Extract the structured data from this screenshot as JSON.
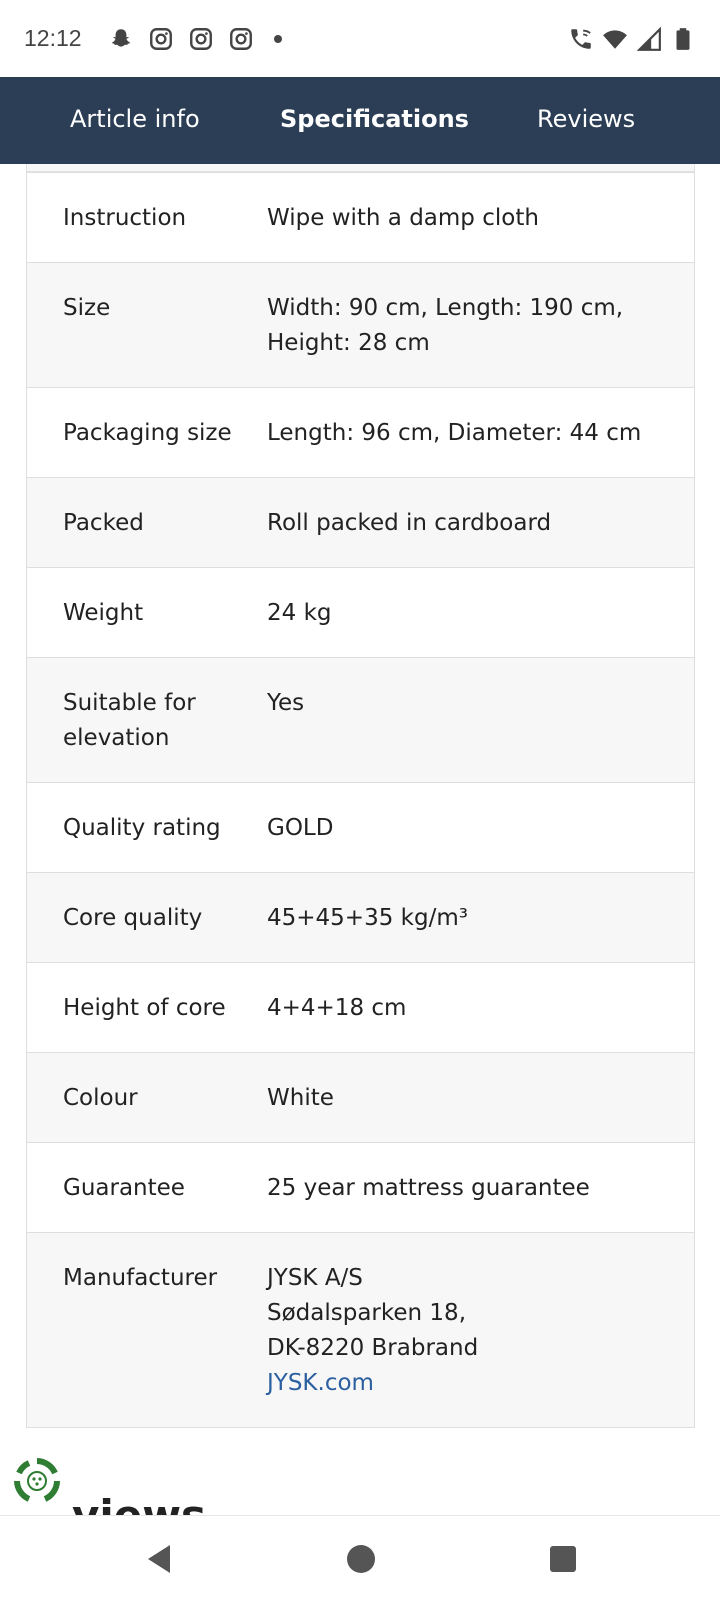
{
  "status_bar": {
    "time": "12:12",
    "left_icons": [
      "snapchat-icon",
      "instagram-icon",
      "instagram-icon",
      "instagram-icon"
    ],
    "right_icons": [
      "wifi-call-icon",
      "wifi-icon",
      "signal-icon",
      "battery-icon"
    ]
  },
  "tabs": [
    {
      "label": "Article info",
      "active": false
    },
    {
      "label": "Specifications",
      "active": true
    },
    {
      "label": "Reviews",
      "active": false
    }
  ],
  "specs": [
    {
      "label": "Instruction",
      "value": "Wipe with a damp cloth"
    },
    {
      "label": "Size",
      "value": "Width: 90 cm, Length: 190 cm, Height: 28 cm"
    },
    {
      "label": "Packaging size",
      "value": "Length: 96 cm, Diameter: 44 cm"
    },
    {
      "label": "Packed",
      "value": "Roll packed in cardboard"
    },
    {
      "label": "Weight",
      "value": "24 kg"
    },
    {
      "label": "Suitable for elevation",
      "value": "Yes"
    },
    {
      "label": "Quality rating",
      "value": "GOLD"
    },
    {
      "label": "Core quality",
      "value": "45+45+35 kg/m³"
    },
    {
      "label": "Height of core",
      "value": "4+4+18 cm"
    },
    {
      "label": "Colour",
      "value": "White"
    },
    {
      "label": "Guarantee",
      "value": "25 year mattress guarantee"
    }
  ],
  "manufacturer": {
    "label": "Manufacturer",
    "name": "JYSK A/S",
    "street": "Sødalsparken 18,",
    "city": "DK-8220 Brabrand",
    "link": "JYSK.com"
  },
  "views_heading": "views",
  "colors": {
    "tab_bar": "#2b3e55",
    "link": "#2b5fa0",
    "alt_row": "#f7f7f7",
    "fab_green": "#2e7d32"
  }
}
